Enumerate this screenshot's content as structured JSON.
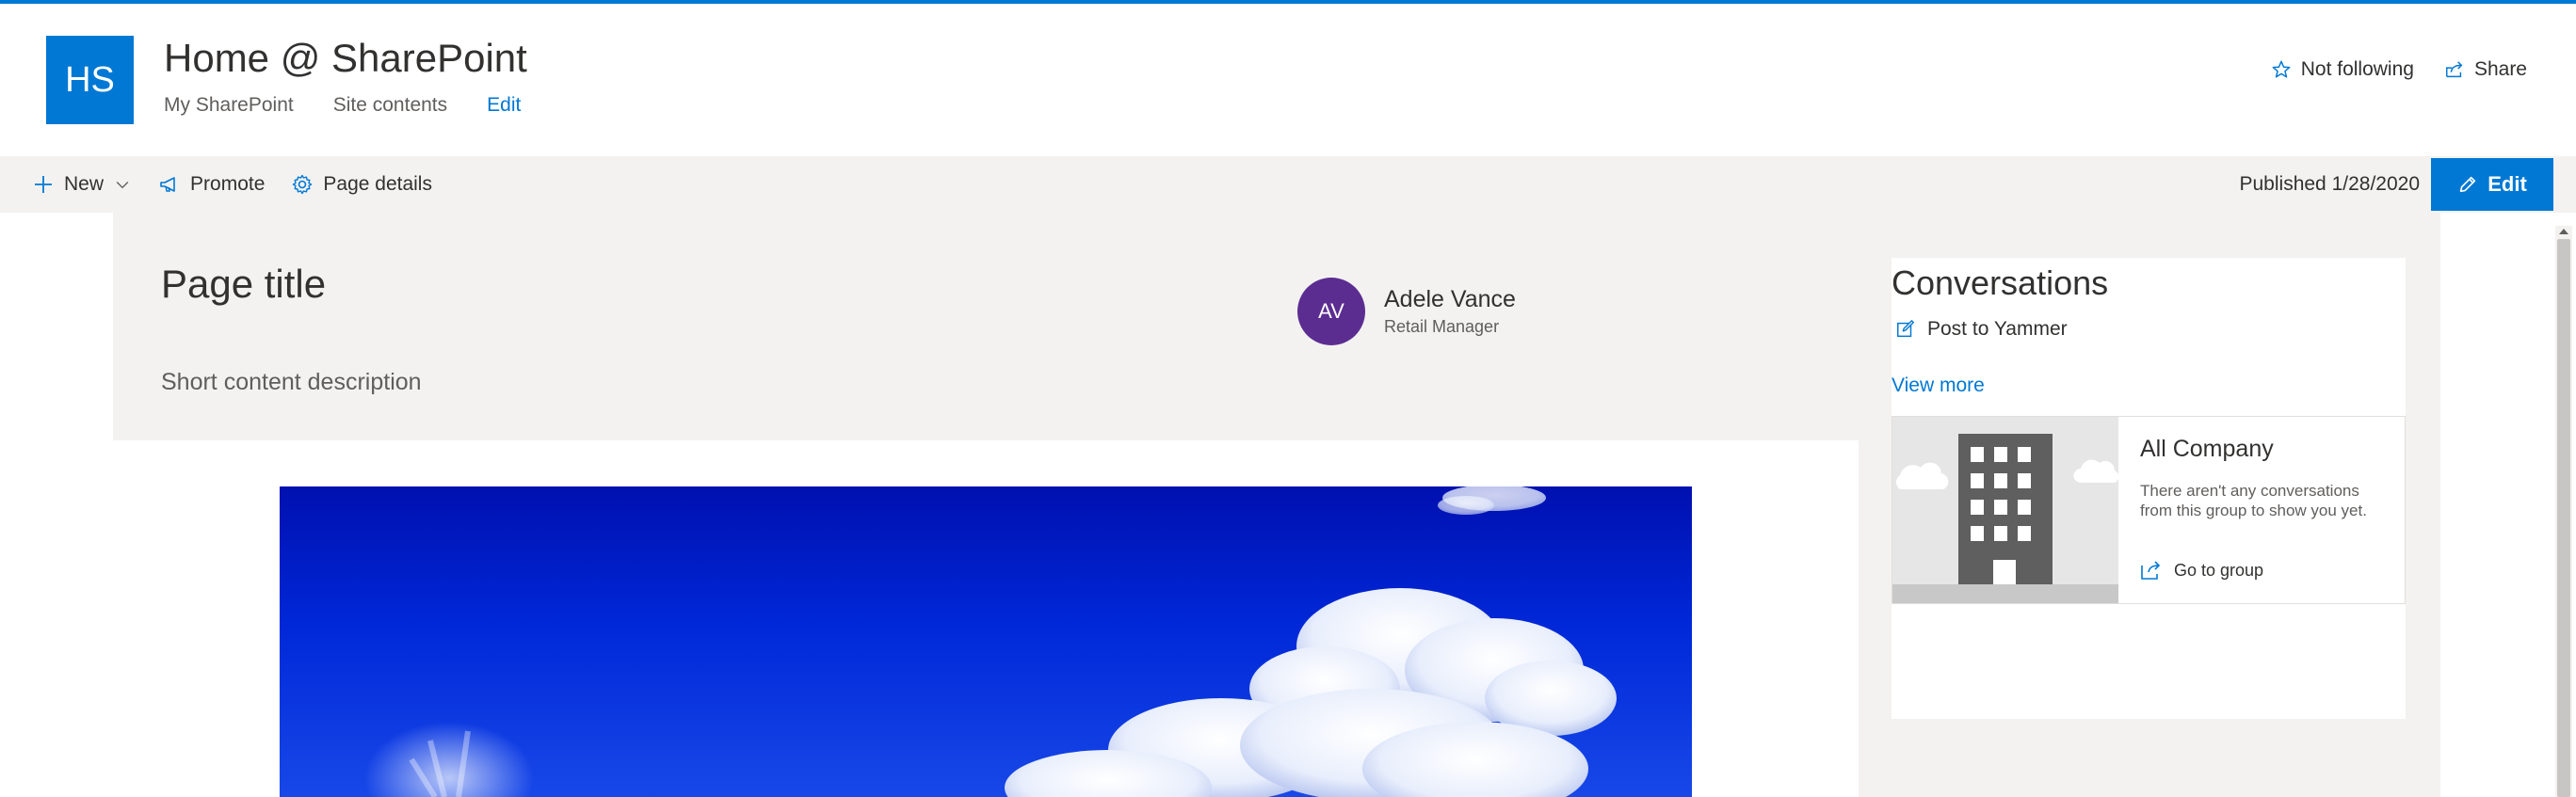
{
  "site": {
    "logo_initials": "HS",
    "title": "Home @ SharePoint",
    "nav": [
      "My SharePoint",
      "Site contents",
      "Edit"
    ],
    "not_following_label": "Not following",
    "share_label": "Share"
  },
  "command_bar": {
    "new_label": "New",
    "promote_label": "Promote",
    "page_details_label": "Page details",
    "published_text": "Published 1/28/2020",
    "edit_label": "Edit"
  },
  "page": {
    "title": "Page title",
    "description": "Short content description",
    "author": {
      "initials": "AV",
      "name": "Adele Vance",
      "role": "Retail Manager"
    }
  },
  "conversations": {
    "title": "Conversations",
    "post_label": "Post to Yammer",
    "view_more_label": "View more",
    "group": {
      "name": "All Company",
      "empty_text": "There aren't any conversations from this group to show you yet.",
      "go_label": "Go to group"
    }
  },
  "colors": {
    "accent": "#0078d4",
    "avatar": "#5c2d91",
    "command_bar_bg": "#f3f2f1"
  }
}
